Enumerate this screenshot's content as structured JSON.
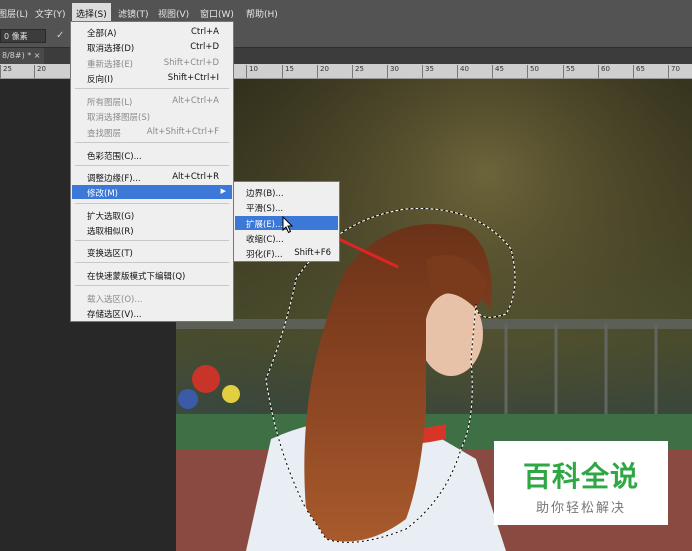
{
  "menubar": {
    "items": [
      {
        "label": "图层(L)"
      },
      {
        "label": "文字(Y)"
      },
      {
        "label": "选择(S)"
      },
      {
        "label": "滤镜(T)"
      },
      {
        "label": "视图(V)"
      },
      {
        "label": "窗口(W)"
      },
      {
        "label": "帮助(H)"
      }
    ]
  },
  "options": {
    "feather_value": "0 像素",
    "check": "✓"
  },
  "document": {
    "tab_label": "8/8#) * ×"
  },
  "ruler": {
    "ticks": [
      "25",
      "20",
      "10",
      "15",
      "20",
      "25",
      "30",
      "35",
      "40",
      "45",
      "50",
      "55",
      "60",
      "65",
      "70"
    ]
  },
  "select_menu": {
    "items": [
      {
        "label": "全部(A)",
        "shortcut": "Ctrl+A",
        "disabled": false
      },
      {
        "label": "取消选择(D)",
        "shortcut": "Ctrl+D",
        "disabled": false
      },
      {
        "label": "重新选择(E)",
        "shortcut": "Shift+Ctrl+D",
        "disabled": true
      },
      {
        "label": "反向(I)",
        "shortcut": "Shift+Ctrl+I",
        "disabled": false
      },
      {
        "label": "所有图层(L)",
        "shortcut": "Alt+Ctrl+A",
        "disabled": true
      },
      {
        "label": "取消选择图层(S)",
        "shortcut": "",
        "disabled": true
      },
      {
        "label": "查找图层",
        "shortcut": "Alt+Shift+Ctrl+F",
        "disabled": true
      },
      {
        "label": "色彩范围(C)...",
        "shortcut": "",
        "disabled": false
      },
      {
        "label": "调整边缘(F)...",
        "shortcut": "Alt+Ctrl+R",
        "disabled": false
      },
      {
        "label": "修改(M)",
        "shortcut": "",
        "disabled": false
      },
      {
        "label": "扩大选取(G)",
        "shortcut": "",
        "disabled": false
      },
      {
        "label": "选取相似(R)",
        "shortcut": "",
        "disabled": false
      },
      {
        "label": "变换选区(T)",
        "shortcut": "",
        "disabled": false
      },
      {
        "label": "在快速蒙版模式下编辑(Q)",
        "shortcut": "",
        "disabled": false
      },
      {
        "label": "载入选区(O)...",
        "shortcut": "",
        "disabled": true
      },
      {
        "label": "存储选区(V)...",
        "shortcut": "",
        "disabled": false
      }
    ],
    "submenu_arrow": "▶"
  },
  "modify_submenu": {
    "items": [
      {
        "label": "边界(B)...",
        "shortcut": ""
      },
      {
        "label": "平滑(S)...",
        "shortcut": ""
      },
      {
        "label": "扩展(E)...",
        "shortcut": ""
      },
      {
        "label": "收缩(C)...",
        "shortcut": ""
      },
      {
        "label": "羽化(F)...",
        "shortcut": "Shift+F6"
      }
    ]
  },
  "watermark": {
    "title": "百科全说",
    "subtitle": "助你轻松解决"
  },
  "colors": {
    "menu_highlight": "#3c78d8",
    "annotation_arrow": "#e02424",
    "watermark_green": "#2fa744"
  }
}
